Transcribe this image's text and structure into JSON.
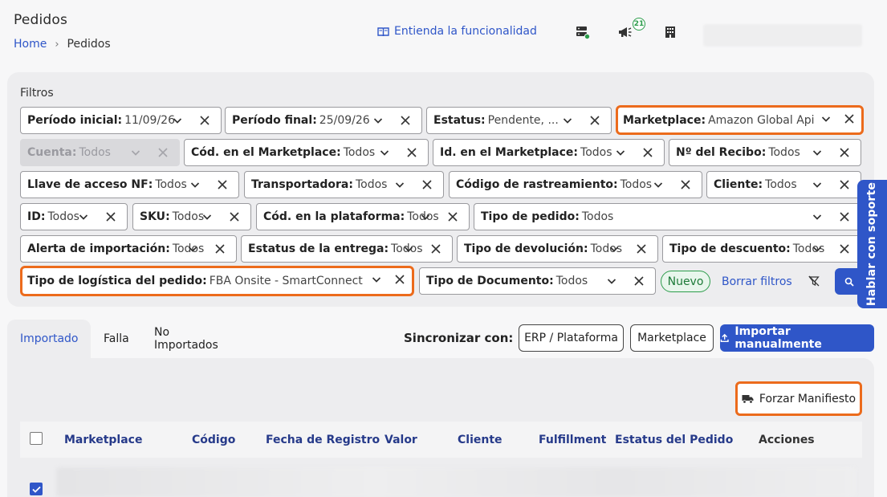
{
  "header": {
    "title": "Pedidos",
    "breadcrumb": {
      "home": "Home",
      "current": "Pedidos"
    },
    "functionality_link": "Entienda la funcionalidad",
    "notification_count": "21",
    "icons": [
      "server-status-icon",
      "megaphone-icon",
      "building-icon"
    ]
  },
  "filters": {
    "title": "Filtros",
    "items": [
      {
        "label": "Período inicial",
        "value": "11/09/26"
      },
      {
        "label": "Período final",
        "value": "25/09/26"
      },
      {
        "label": "Estatus",
        "value": "Pendente, ..."
      },
      {
        "label": "Marketplace",
        "value": "Amazon Global Api",
        "highlighted": true
      },
      {
        "label": "Cuenta",
        "value": "Todos",
        "disabled": true
      },
      {
        "label": "Cód. en el Marketplace",
        "value": "Todos"
      },
      {
        "label": "Id. en el Marketplace",
        "value": "Todos"
      },
      {
        "label": "Nº del Recibo",
        "value": "Todos"
      },
      {
        "label": "Llave de acceso NF",
        "value": "Todos"
      },
      {
        "label": "Transportadora",
        "value": "Todos"
      },
      {
        "label": "Código de rastreamiento",
        "value": "Todos"
      },
      {
        "label": "Cliente",
        "value": "Todos"
      },
      {
        "label": "ID",
        "value": "Todos"
      },
      {
        "label": "SKU",
        "value": "Todos"
      },
      {
        "label": "Cód. en la plataforma",
        "value": "Todos"
      },
      {
        "label": "Tipo de pedido",
        "value": "Todos"
      },
      {
        "label": "Alerta de importación",
        "value": "Todos"
      },
      {
        "label": "Estatus de la entrega",
        "value": "Todos"
      },
      {
        "label": "Tipo de devolución",
        "value": "Todos"
      },
      {
        "label": "Tipo de descuento",
        "value": "Todos"
      },
      {
        "label": "Tipo de logística del pedido",
        "value": "FBA Onsite - SmartConnect",
        "highlighted": true
      },
      {
        "label": "Tipo de Documento",
        "value": "Todos"
      }
    ],
    "new_badge": "Nuevo",
    "clear_label": "Borrar filtros"
  },
  "support": {
    "label": "Hablar con soporte"
  },
  "tabs": [
    "Importado",
    "Falla",
    "No Importados"
  ],
  "sync": {
    "label": "Sincronizar con:",
    "erp_button": "ERP / Plataforma",
    "marketplace_button": "Marketplace",
    "import_button": "Importar manualmente"
  },
  "manifest_button": "Forzar Manifiesto",
  "table": {
    "columns": [
      "Marketplace",
      "Código",
      "Fecha de Registro",
      "Valor",
      "Cliente",
      "Fulfillment",
      "Estatus del Pedido",
      "Acciones"
    ]
  },
  "colors": {
    "accent": "#2f56c8",
    "highlight": "#ec6b1c",
    "success": "#2c9c4b"
  }
}
